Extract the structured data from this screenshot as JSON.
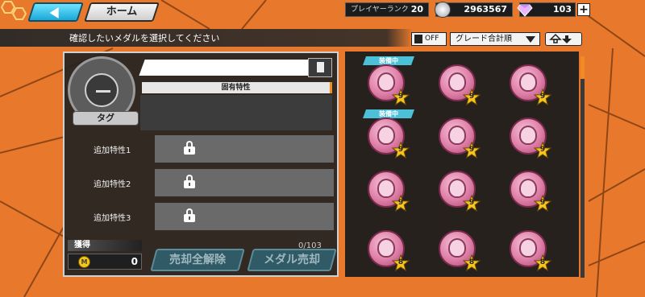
{
  "header": {
    "home_label": "ホーム",
    "rank_label": "プレイヤーランク",
    "rank_value": "20",
    "coins": "2963567",
    "gems": "103",
    "plus_label": "+"
  },
  "toolbar": {
    "instruction": "確認したいメダルを選択してください",
    "favorite_filter": "OFF",
    "sort_label": "グレード合計順"
  },
  "detail": {
    "inherent_trait_header": "固有特性",
    "tag_label": "タグ",
    "traits": [
      {
        "label": "追加特性1"
      },
      {
        "label": "追加特性2"
      },
      {
        "label": "追加特性3"
      }
    ]
  },
  "acquire": {
    "label": "獲得",
    "currency_icon": "M",
    "value": "0"
  },
  "sell": {
    "count": "0/103",
    "unsell_all_label": "売却全解除",
    "sell_label": "メダル売却"
  },
  "medals": [
    {
      "grade": "9",
      "equipped": "装備中"
    },
    {
      "grade": "9",
      "equipped": ""
    },
    {
      "grade": "9",
      "equipped": ""
    },
    {
      "grade": "9",
      "equipped": "装備中"
    },
    {
      "grade": "9",
      "equipped": ""
    },
    {
      "grade": "9",
      "equipped": ""
    },
    {
      "grade": "9",
      "equipped": ""
    },
    {
      "grade": "9",
      "equipped": ""
    },
    {
      "grade": "9",
      "equipped": ""
    },
    {
      "grade": "8",
      "equipped": ""
    },
    {
      "grade": "8",
      "equipped": ""
    },
    {
      "grade": "8",
      "equipped": ""
    }
  ],
  "colors": {
    "background": "#e8792c",
    "accent_orange": "#f28c1c",
    "back_button": "#1aa8d8",
    "equip_tag": "#4cc0d8",
    "medal_pink": "#de7ea6"
  }
}
